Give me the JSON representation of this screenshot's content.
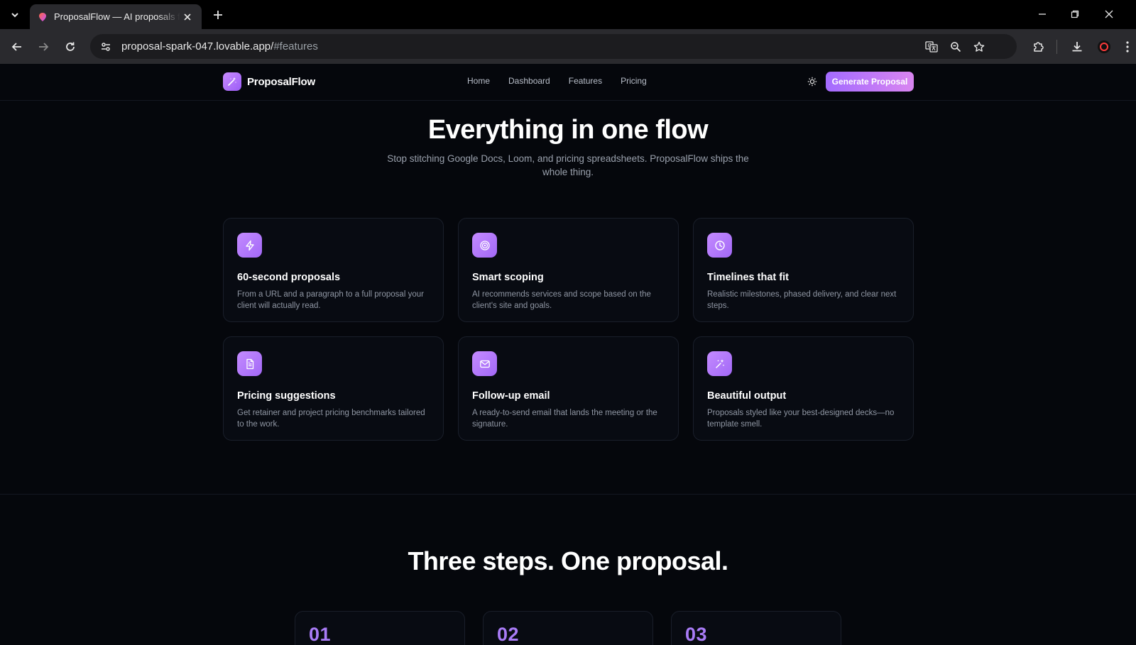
{
  "browser": {
    "tab_title": "ProposalFlow — AI proposals for agencies",
    "url_host": "proposal-spark-047.lovable.app/",
    "url_path": "#features"
  },
  "header": {
    "brand": "ProposalFlow",
    "nav": [
      "Home",
      "Dashboard",
      "Features",
      "Pricing"
    ],
    "cta": "Generate Proposal"
  },
  "features": {
    "title": "Everything in one flow",
    "subtitle": "Stop stitching Google Docs, Loom, and pricing spreadsheets. ProposalFlow ships the whole thing.",
    "cards": [
      {
        "icon": "lightning-icon",
        "title": "60-second proposals",
        "desc": "From a URL and a paragraph to a full proposal your client will actually read."
      },
      {
        "icon": "target-icon",
        "title": "Smart scoping",
        "desc": "AI recommends services and scope based on the client's site and goals."
      },
      {
        "icon": "clock-icon",
        "title": "Timelines that fit",
        "desc": "Realistic milestones, phased delivery, and clear next steps."
      },
      {
        "icon": "document-icon",
        "title": "Pricing suggestions",
        "desc": "Get retainer and project pricing benchmarks tailored to the work."
      },
      {
        "icon": "mail-icon",
        "title": "Follow-up email",
        "desc": "A ready-to-send email that lands the meeting or the signature."
      },
      {
        "icon": "sparkles-icon",
        "title": "Beautiful output",
        "desc": "Proposals styled like your best-designed decks—no template smell."
      }
    ]
  },
  "steps": {
    "title": "Three steps. One proposal.",
    "numbers": [
      "01",
      "02",
      "03"
    ]
  },
  "colors": {
    "accent": "#a36bff",
    "accent_pink": "#d985f0",
    "background": "#05070c",
    "card_bg": "#080b12"
  }
}
